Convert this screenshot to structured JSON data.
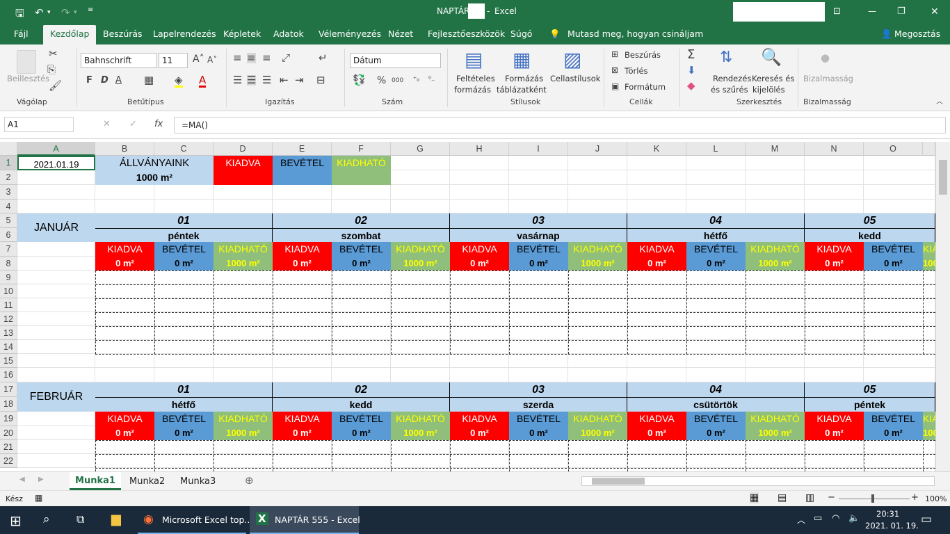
{
  "window": {
    "title": "NAPTÁR",
    "app": "Excel"
  },
  "qat": {
    "save": "save-icon",
    "undo": "undo-icon",
    "redo": "redo-icon",
    "more": "more-icon"
  },
  "menu": [
    "Fájl",
    "Kezdőlap",
    "Beszúrás",
    "Lapelrendezés",
    "Képletek",
    "Adatok",
    "Véleményezés",
    "Nézet",
    "Fejlesztőeszközök",
    "Súgó"
  ],
  "tellme": "Mutasd meg, hogyan csináljam",
  "share": "Megosztás",
  "ribbon": {
    "clipboard": {
      "paste": "Beillesztés",
      "group": "Vágólap"
    },
    "font": {
      "name": "Bahnschrift",
      "size": "11",
      "bold": "F",
      "italic": "D",
      "underline": "A",
      "group": "Betűtípus"
    },
    "align": {
      "group": "Igazítás"
    },
    "number": {
      "format": "Dátum",
      "percent": "%",
      "thousands": "000",
      "group": "Szám"
    },
    "styles": {
      "cond1": "Feltételes",
      "cond2": "formázás",
      "table1": "Formázás",
      "table2": "táblázatként",
      "cell": "Cellastílusok",
      "group": "Stílusok"
    },
    "cells": {
      "insert": "Beszúrás",
      "delete": "Törlés",
      "format": "Formátum",
      "group": "Cellák"
    },
    "editing": {
      "sort1": "Rendezés",
      "sort2": "és szűrés",
      "find1": "Keresés és",
      "find2": "kijelölés",
      "group": "Szerkesztés"
    },
    "sens": {
      "label": "Bizalmasság",
      "group": "Bizalmasság"
    }
  },
  "formula": {
    "namebox": "A1",
    "fx": "fx",
    "value": "=MA()"
  },
  "columns": [
    "A",
    "B",
    "C",
    "D",
    "E",
    "F",
    "G",
    "H",
    "I",
    "J",
    "K",
    "L",
    "M",
    "N",
    "O"
  ],
  "rows": [
    "1",
    "2",
    "3",
    "4",
    "5",
    "6",
    "7",
    "8",
    "9",
    "10",
    "11",
    "12",
    "13",
    "14",
    "15",
    "16",
    "17",
    "18",
    "19",
    "20",
    "21",
    "22"
  ],
  "cells": {
    "a1": "2021.01.19",
    "b1": "ÁLLVÁNYAINK",
    "d1": "KIADVA",
    "e1": "BEVÉTEL",
    "f1": "KIADHATÓ",
    "b2": "1000 m²",
    "month1": "JANUÁR",
    "month2": "FEBRUÁR"
  },
  "kiadva": "KIADVA",
  "bevetel": "BEVÉTEL",
  "kiadhato": "KIADHATÓ",
  "val0": "0 m²",
  "val1000": "1000 m²",
  "jan": [
    {
      "num": "01",
      "day": "péntek"
    },
    {
      "num": "02",
      "day": "szombat"
    },
    {
      "num": "03",
      "day": "vasárnap"
    },
    {
      "num": "04",
      "day": "hétfő"
    },
    {
      "num": "05",
      "day": "kedd"
    }
  ],
  "feb": [
    {
      "num": "01",
      "day": "hétfő"
    },
    {
      "num": "02",
      "day": "kedd"
    },
    {
      "num": "03",
      "day": "szerda"
    },
    {
      "num": "04",
      "day": "csütörtök"
    },
    {
      "num": "05",
      "day": "péntek"
    }
  ],
  "sheets": [
    "Munka1",
    "Munka2",
    "Munka3"
  ],
  "status": {
    "ready": "Kész",
    "zoom": "100%"
  },
  "taskbar": {
    "app1": "Microsoft Excel top...",
    "app2": "NAPTÁR 555 - Excel",
    "time": "20:31",
    "date": "2021. 01. 19."
  }
}
